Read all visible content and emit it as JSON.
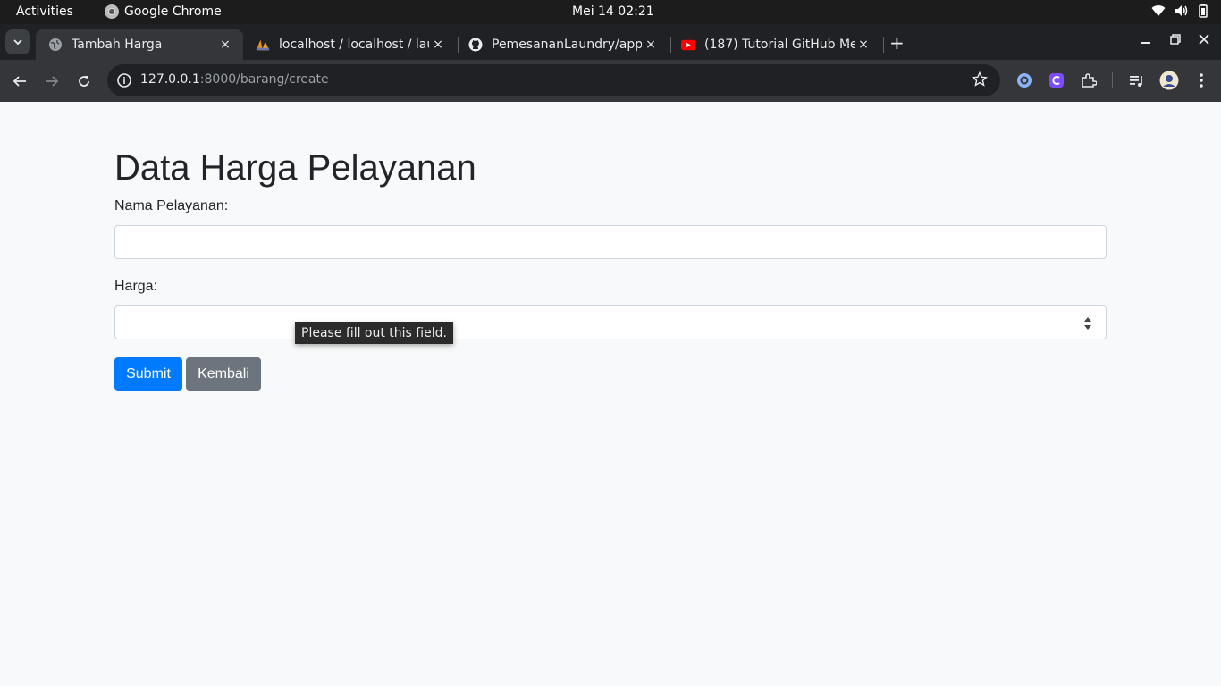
{
  "system_bar": {
    "activities": "Activities",
    "app_name": "Google Chrome",
    "clock": "Mei 14  02:21"
  },
  "tabs": [
    {
      "title": "Tambah Harga",
      "active": true
    },
    {
      "title": "localhost / localhost / lau",
      "active": false
    },
    {
      "title": "PemesananLaundry/app",
      "active": false
    },
    {
      "title": "(187) Tutorial GitHub Me",
      "active": false
    }
  ],
  "tab_close_glyph": "×",
  "new_tab_glyph": "+",
  "address_bar": {
    "host": "127.0.0.1",
    "path": ":8000/barang/create"
  },
  "page": {
    "heading": "Data Harga Pelayanan",
    "name_label": "Nama Pelayanan:",
    "name_value": "",
    "price_label": "Harga:",
    "price_value": "",
    "submit_label": "Submit",
    "back_label": "Kembali",
    "validation_tooltip": "Please fill out this field."
  },
  "colors": {
    "primary": "#007bff",
    "secondary": "#6c757d",
    "page_bg": "#f8f9fa"
  }
}
